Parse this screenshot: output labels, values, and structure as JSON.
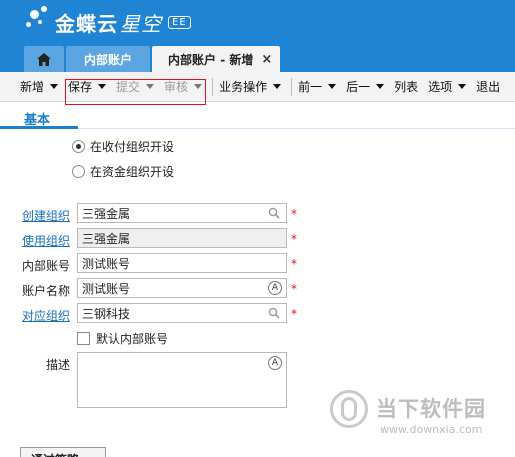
{
  "app": {
    "brand": "金蝶云",
    "brand_sub": "星空",
    "badge": "EE"
  },
  "tabs": [
    {
      "label": "内部账户"
    },
    {
      "label": "内部账户 - 新增",
      "close": "×"
    }
  ],
  "toolbar": {
    "new": "新增",
    "save": "保存",
    "submit": "提交",
    "audit": "审核",
    "business": "业务操作",
    "prev": "前一",
    "next": "后一",
    "list": "列表",
    "options": "选项",
    "exit": "退出"
  },
  "section": {
    "basic": "基本"
  },
  "radios": [
    {
      "label": "在收付组织开设",
      "checked": true
    },
    {
      "label": "在资金组织开设",
      "checked": false
    }
  ],
  "form": {
    "create_org": {
      "label": "创建组织",
      "value": "三强金属"
    },
    "use_org": {
      "label": "使用组织",
      "value": "三强金属"
    },
    "account_no": {
      "label": "内部账号",
      "value": "测试账号"
    },
    "account_name": {
      "label": "账户名称",
      "value": "测试账号"
    },
    "counter_org": {
      "label": "对应组织",
      "value": "三钢科技"
    },
    "default_checkbox": "默认内部账号",
    "description": {
      "label": "描述",
      "value": ""
    },
    "required_mark": "*"
  },
  "bottom": {
    "button": "通过策略"
  },
  "watermark": {
    "text": "当下软件园",
    "url": "www.downxia.com"
  },
  "colors": {
    "header": "#1f84d3",
    "accent": "#1a7fce",
    "required": "#e0141c"
  }
}
